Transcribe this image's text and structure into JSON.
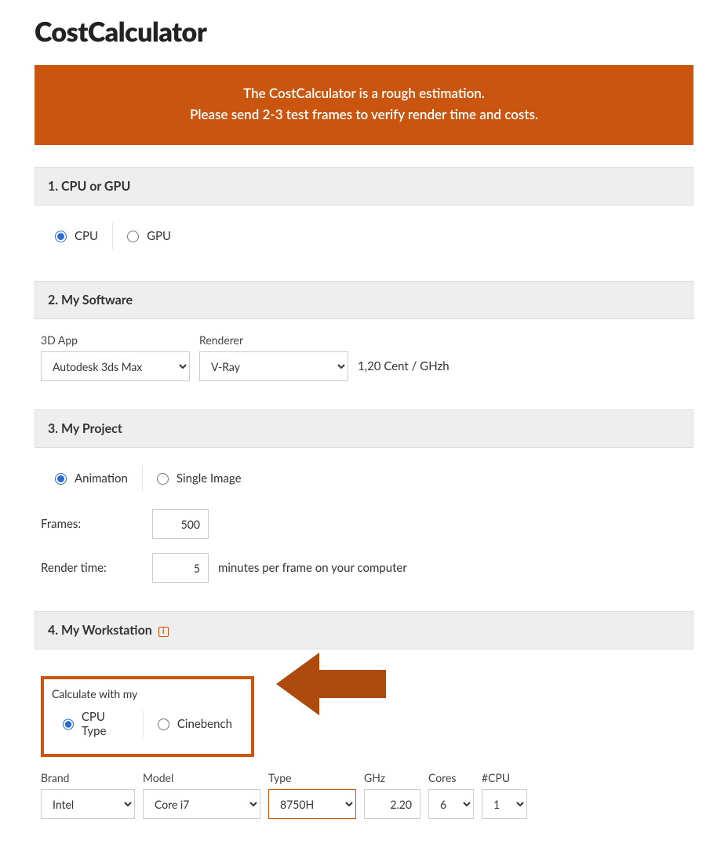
{
  "title": "CostCalculator",
  "notice": {
    "line1": "The CostCalculator is a rough estimation.",
    "line2": "Please send 2-3 test frames to verify render time and costs."
  },
  "sections": {
    "s1": {
      "title": "1. CPU or GPU",
      "opt_cpu": "CPU",
      "opt_gpu": "GPU"
    },
    "s2": {
      "title": "2. My Software",
      "app_label": "3D App",
      "renderer_label": "Renderer",
      "app_value": "Autodesk 3ds Max",
      "renderer_value": "V-Ray",
      "price_text": "1,20 Cent / GHzh"
    },
    "s3": {
      "title": "3. My Project",
      "opt_anim": "Animation",
      "opt_single": "Single Image",
      "frames_label": "Frames:",
      "frames_value": "500",
      "rt_label": "Render time:",
      "rt_value": "5",
      "rt_suffix": "minutes per frame on your computer"
    },
    "s4": {
      "title": "4. My Workstation",
      "calc_label": "Calculate with my",
      "opt_cputype": "CPU Type",
      "opt_cinebench": "Cinebench",
      "brand_label": "Brand",
      "model_label": "Model",
      "type_label": "Type",
      "ghz_label": "GHz",
      "cores_label": "Cores",
      "ncpu_label": "#CPU",
      "brand_value": "Intel",
      "model_value": "Core i7",
      "type_value": "8750H",
      "ghz_value": "2.20",
      "cores_value": "6",
      "ncpu_value": "1"
    }
  }
}
